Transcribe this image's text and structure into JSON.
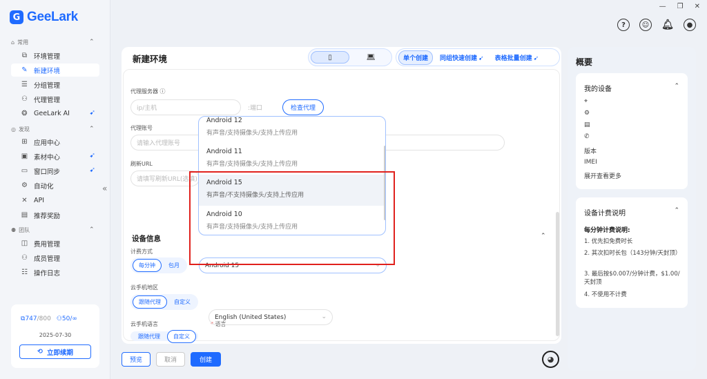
{
  "app": {
    "name": "GeeLark"
  },
  "sidebar": {
    "group_common": "常用",
    "group_discover": "发现",
    "group_team": "团队",
    "items": [
      {
        "label": "环境管理",
        "icon": "environment-icon"
      },
      {
        "label": "新建环境",
        "icon": "new-environment-icon",
        "active": true
      },
      {
        "label": "分组管理",
        "icon": "group-icon"
      },
      {
        "label": "代理管理",
        "icon": "proxy-icon"
      },
      {
        "label": "GeeLark AI",
        "icon": "ai-icon",
        "pinned": true
      },
      {
        "label": "应用中心",
        "icon": "app-center-icon"
      },
      {
        "label": "素材中心",
        "icon": "material-icon",
        "pinned": true
      },
      {
        "label": "窗口同步",
        "icon": "window-sync-icon",
        "pinned": true
      },
      {
        "label": "自动化",
        "icon": "automation-icon"
      },
      {
        "label": "API",
        "icon": "api-icon"
      },
      {
        "label": "推荐奖励",
        "icon": "reward-icon"
      },
      {
        "label": "费用管理",
        "icon": "billing-icon"
      },
      {
        "label": "成员管理",
        "icon": "members-icon"
      },
      {
        "label": "操作日志",
        "icon": "log-icon"
      }
    ],
    "quota": {
      "devices": "747",
      "devices_total": "/800",
      "members": "50/∞",
      "date": "2025-07-30",
      "renew": "立即续期"
    }
  },
  "page": {
    "title": "新建环境",
    "device_tabs": [
      "phone",
      "desktop"
    ],
    "mode_tabs": [
      "单个创建",
      "同组快速创建",
      "表格批量创建"
    ]
  },
  "form": {
    "proxy_server_label": "代理服务器",
    "proxy_host_placeholder": "ip/主机",
    "proxy_port_placeholder": ":端口",
    "check_proxy": "检查代理",
    "proxy_account_label": "代理账号",
    "proxy_account_placeholder": "请输入代理账号",
    "refresh_url_label": "刷新URL",
    "refresh_url_placeholder": "请填写刷新URL(选填)",
    "device_info_title": "设备信息",
    "billing_label": "计费方式",
    "billing_options": [
      "每分钟",
      "包月"
    ],
    "region_label": "云手机地区",
    "region_options": [
      "跟随代理",
      "自定义"
    ],
    "language_label": "云手机语言",
    "language_options": [
      "跟随代理",
      "自定义"
    ],
    "language_field_label": "语言",
    "language_value": "English (United States)",
    "android_value": "Android 15"
  },
  "dropdown": {
    "options": [
      {
        "name": "Android 12",
        "desc": "有声音/支持摄像头/支持上传应用"
      },
      {
        "name": "Android 11",
        "desc": "有声音/支持摄像头/支持上传应用"
      },
      {
        "name": "Android 15",
        "desc": "有声音/不支持摄像头/支持上传应用",
        "selected": true
      },
      {
        "name": "Android 10",
        "desc": "有声音/支持摄像头/支持上传应用"
      }
    ]
  },
  "footer": {
    "preview": "预览",
    "cancel": "取消",
    "create": "创建"
  },
  "overview": {
    "title": "概要",
    "my_device": {
      "title": "我的设备",
      "rows": [
        "版本",
        "IMEI"
      ],
      "more": "展开查看更多"
    },
    "billing": {
      "title": "设备计费说明",
      "subtitle": "每分钟计费说明:",
      "items": [
        "1. 优先扣免费时长",
        "2. 其次扣时长包（143分钟/天封顶）",
        "3. 最后按$0.007/分钟计费，$1.00/天封顶",
        "4. 不使用不计费"
      ]
    }
  },
  "colors": {
    "accent": "#1f6bff",
    "highlight": "#e0201c"
  }
}
